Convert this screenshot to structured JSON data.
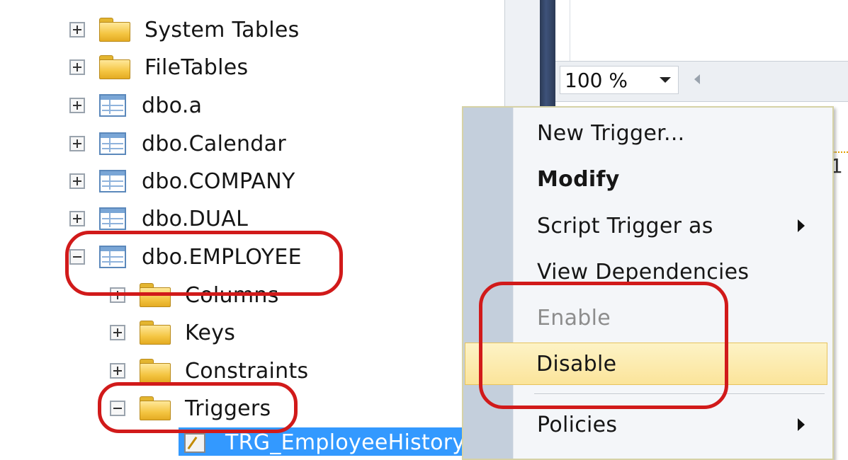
{
  "tree": {
    "nodes": [
      {
        "label": "System Tables",
        "icon": "folder-icon",
        "expander": "plus"
      },
      {
        "label": "FileTables",
        "icon": "folder-icon",
        "expander": "plus"
      },
      {
        "label": "dbo.a",
        "icon": "table-icon",
        "expander": "plus"
      },
      {
        "label": "dbo.Calendar",
        "icon": "table-icon",
        "expander": "plus"
      },
      {
        "label": "dbo.COMPANY",
        "icon": "table-icon",
        "expander": "plus"
      },
      {
        "label": "dbo.DUAL",
        "icon": "table-icon",
        "expander": "plus"
      },
      {
        "label": "dbo.EMPLOYEE",
        "icon": "table-icon",
        "expander": "minus"
      },
      {
        "label": "Columns",
        "icon": "folder-icon",
        "expander": "plus"
      },
      {
        "label": "Keys",
        "icon": "folder-icon",
        "expander": "plus"
      },
      {
        "label": "Constraints",
        "icon": "folder-icon",
        "expander": "plus"
      },
      {
        "label": "Triggers",
        "icon": "folder-icon",
        "expander": "minus"
      }
    ],
    "selected_label": "TRG_EmployeeHistory"
  },
  "editor": {
    "zoom": "100 %",
    "glyph": "1"
  },
  "context_menu": {
    "items": [
      {
        "label": "New Trigger..."
      },
      {
        "label": "Modify"
      },
      {
        "label": "Script Trigger as"
      },
      {
        "label": "View Dependencies"
      },
      {
        "label": "Enable"
      },
      {
        "label": "Disable"
      },
      {
        "label": "Policies"
      }
    ]
  },
  "colors": {
    "annotation": "#d11a1a",
    "selection": "#3399ff",
    "menu_hover": "#fbe49a"
  }
}
